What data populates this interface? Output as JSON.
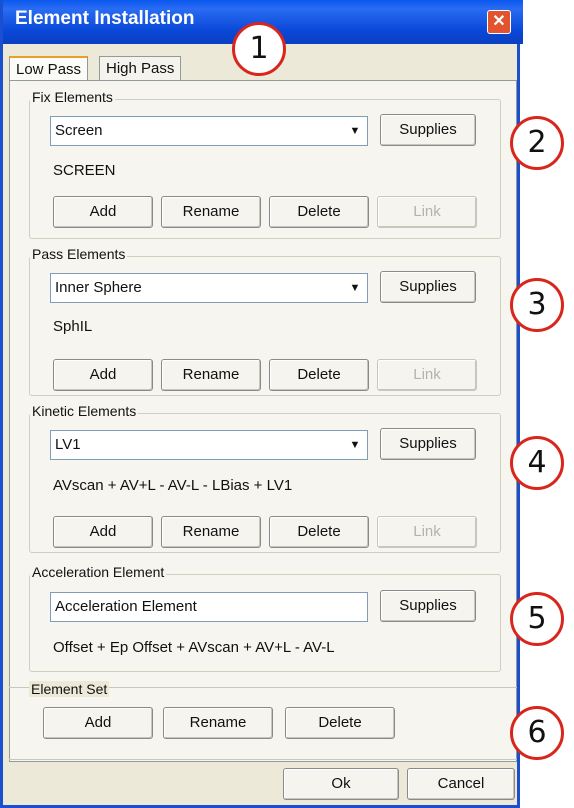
{
  "window": {
    "title": "Element Installation",
    "close_glyph": "✕"
  },
  "tabs": [
    {
      "label": "Low Pass",
      "active": true
    },
    {
      "label": "High Pass",
      "active": false
    }
  ],
  "fix": {
    "label": "Fix Elements",
    "combo_value": "Screen",
    "supplies": "Supplies",
    "static": "SCREEN",
    "buttons": [
      "Add",
      "Rename",
      "Delete",
      "Link"
    ]
  },
  "pass": {
    "label": "Pass Elements",
    "combo_value": "Inner Sphere",
    "supplies": "Supplies",
    "static": "SphIL",
    "buttons": [
      "Add",
      "Rename",
      "Delete",
      "Link"
    ]
  },
  "kinetic": {
    "label": "Kinetic Elements",
    "combo_value": "LV1",
    "supplies": "Supplies",
    "static": "AVscan + AV+L - AV-L - LBias + LV1",
    "buttons": [
      "Add",
      "Rename",
      "Delete",
      "Link"
    ]
  },
  "acceleration": {
    "label": "Acceleration Element",
    "field_value": "Acceleration Element",
    "supplies": "Supplies",
    "static": "Offset + Ep Offset + AVscan + AV+L - AV-L"
  },
  "element_set": {
    "label": "Element Set",
    "buttons": [
      "Add",
      "Rename",
      "Delete"
    ]
  },
  "footer": {
    "ok": "Ok",
    "cancel": "Cancel"
  },
  "callouts": [
    "1",
    "2",
    "3",
    "4",
    "5",
    "6"
  ],
  "colors": {
    "titlebar": "#0a58f0",
    "close": "#e2532f",
    "callout_border": "#d8261c",
    "dialog_bg": "#ece9d8"
  },
  "icons": {
    "combo_arrow": "▼"
  }
}
